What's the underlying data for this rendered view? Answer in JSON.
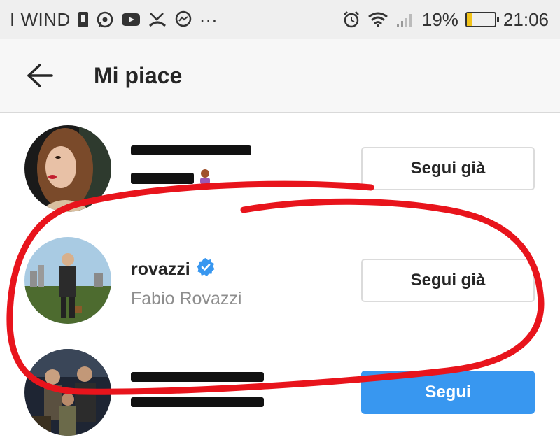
{
  "status_bar": {
    "carrier": "I WIND",
    "more_indicator": "···",
    "battery_percent_label": "19%",
    "battery_level": 0.19,
    "time": "21:06",
    "icons": [
      "sim-card-icon",
      "whatsapp-icon",
      "youtube-icon",
      "missed-call-icon",
      "messenger-icon",
      "alarm-icon",
      "wifi-icon",
      "signal-icon",
      "battery-icon"
    ]
  },
  "header": {
    "title": "Mi piace",
    "back_icon": "arrow-back-icon"
  },
  "likes": [
    {
      "username": "",
      "full_name": "",
      "redacted": true,
      "button_label": "Segui già",
      "button_style": "outline"
    },
    {
      "username": "rovazzi",
      "verified": true,
      "full_name": "Fabio Rovazzi",
      "button_label": "Segui già",
      "button_style": "outline"
    },
    {
      "username": "",
      "full_name": "",
      "redacted": true,
      "button_label": "Segui",
      "button_style": "primary"
    }
  ],
  "colors": {
    "follow_blue": "#3897f0",
    "verified_blue": "#3897f0",
    "annotation_red": "#e8141c",
    "status_bar_bg": "#efefef"
  }
}
